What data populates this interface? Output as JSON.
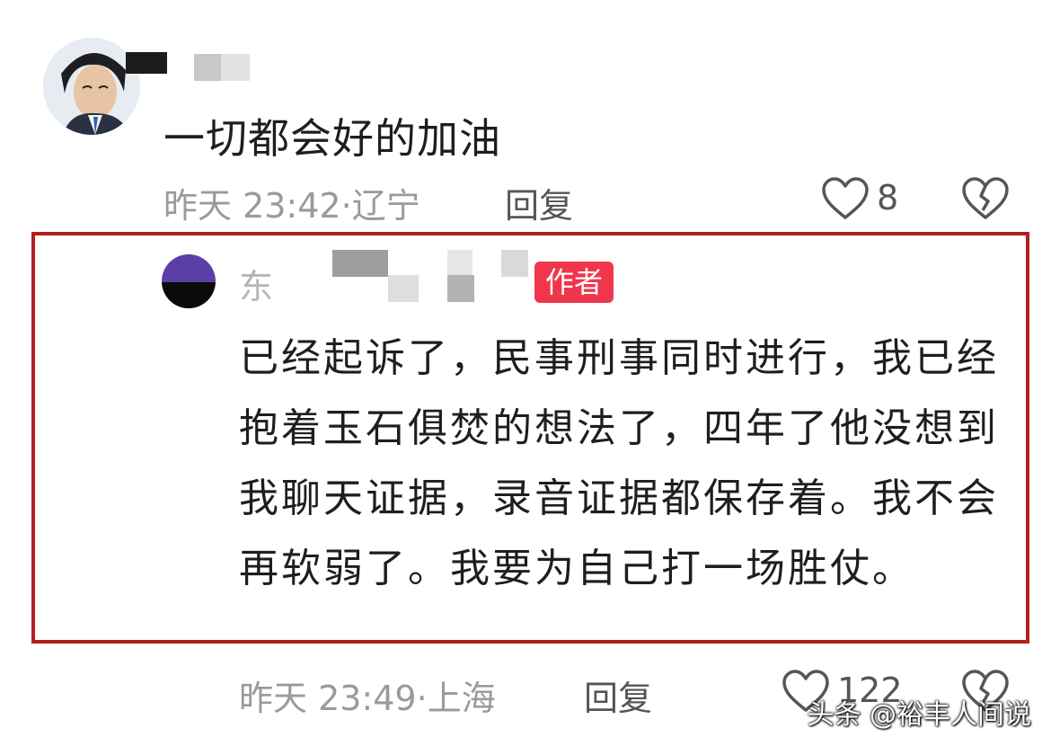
{
  "comment": {
    "text": "一切都会好的加油",
    "time": "昨天 23:42",
    "location": "辽宁",
    "reply_label": "回复",
    "like_count": "8"
  },
  "reply": {
    "name_visible": "东",
    "badge": "作者",
    "text": "已经起诉了，民事刑事同时进行，我已经抱着玉石俱焚的想法了，四年了他没想到我聊天证据，录音证据都保存着。我不会再软弱了。我要为自己打一场胜仗。",
    "time": "昨天 23:49",
    "location": "上海",
    "reply_label": "回复",
    "like_count": "122"
  },
  "separator": "·",
  "watermark": "头条 @裕丰人间说",
  "colors": {
    "highlight_border": "#b3201c",
    "badge_bg": "#f0364d",
    "meta_text": "#9a9a9a"
  },
  "icons": [
    "heart-icon",
    "broken-heart-icon"
  ]
}
